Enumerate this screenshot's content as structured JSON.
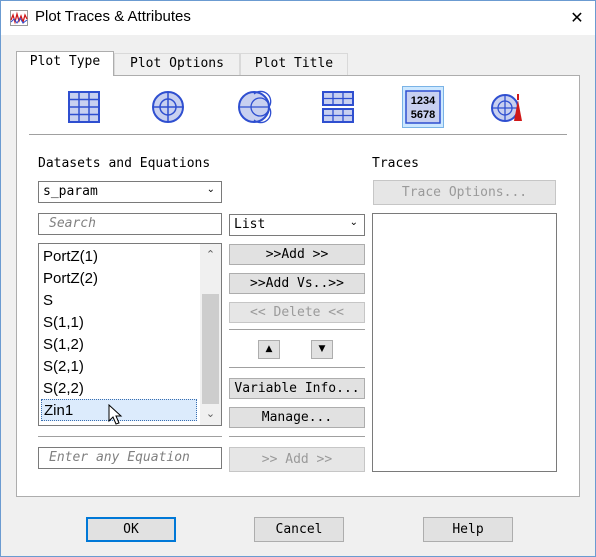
{
  "window": {
    "title": "Plot Traces & Attributes",
    "close_glyph": "✕"
  },
  "tabs": [
    {
      "label": "Plot Type",
      "active": true
    },
    {
      "label": "Plot Options",
      "active": false
    },
    {
      "label": "Plot Title",
      "active": false
    }
  ],
  "plot_types": [
    {
      "icon": "rectangular-plot-icon",
      "selected": false
    },
    {
      "icon": "polar-plot-icon",
      "selected": false
    },
    {
      "icon": "smith-chart-icon",
      "selected": false
    },
    {
      "icon": "stacked-rectangular-plot-icon",
      "selected": false
    },
    {
      "icon": "list-table-icon",
      "selected": true,
      "text_top": "1234",
      "text_bottom": "5678"
    },
    {
      "icon": "antenna-plot-icon",
      "selected": false
    }
  ],
  "datasets": {
    "label": "Datasets and Equations",
    "selected": "s_param",
    "search_placeholder": "Search",
    "items": [
      "PortZ(1)",
      "PortZ(2)",
      "S",
      "S(1,1)",
      "S(1,2)",
      "S(2,1)",
      "S(2,2)",
      "Zin1"
    ],
    "selected_item": "Zin1",
    "equation_placeholder": "Enter any Equation"
  },
  "middle": {
    "view_mode": "List",
    "add": ">>Add >>",
    "add_vs": ">>Add Vs..>>",
    "delete": "<< Delete <<",
    "up_glyph": "▲",
    "down_glyph": "▼",
    "variable_info": "Variable Info...",
    "manage": "Manage...",
    "add_equation": ">> Add >>"
  },
  "traces": {
    "label": "Traces",
    "trace_options": "Trace Options..."
  },
  "footer": {
    "ok": "OK",
    "cancel": "Cancel",
    "help": "Help"
  },
  "colors": {
    "accent": "#0078d7",
    "icon_blue": "#2f4fd0",
    "icon_red": "#d01818"
  }
}
